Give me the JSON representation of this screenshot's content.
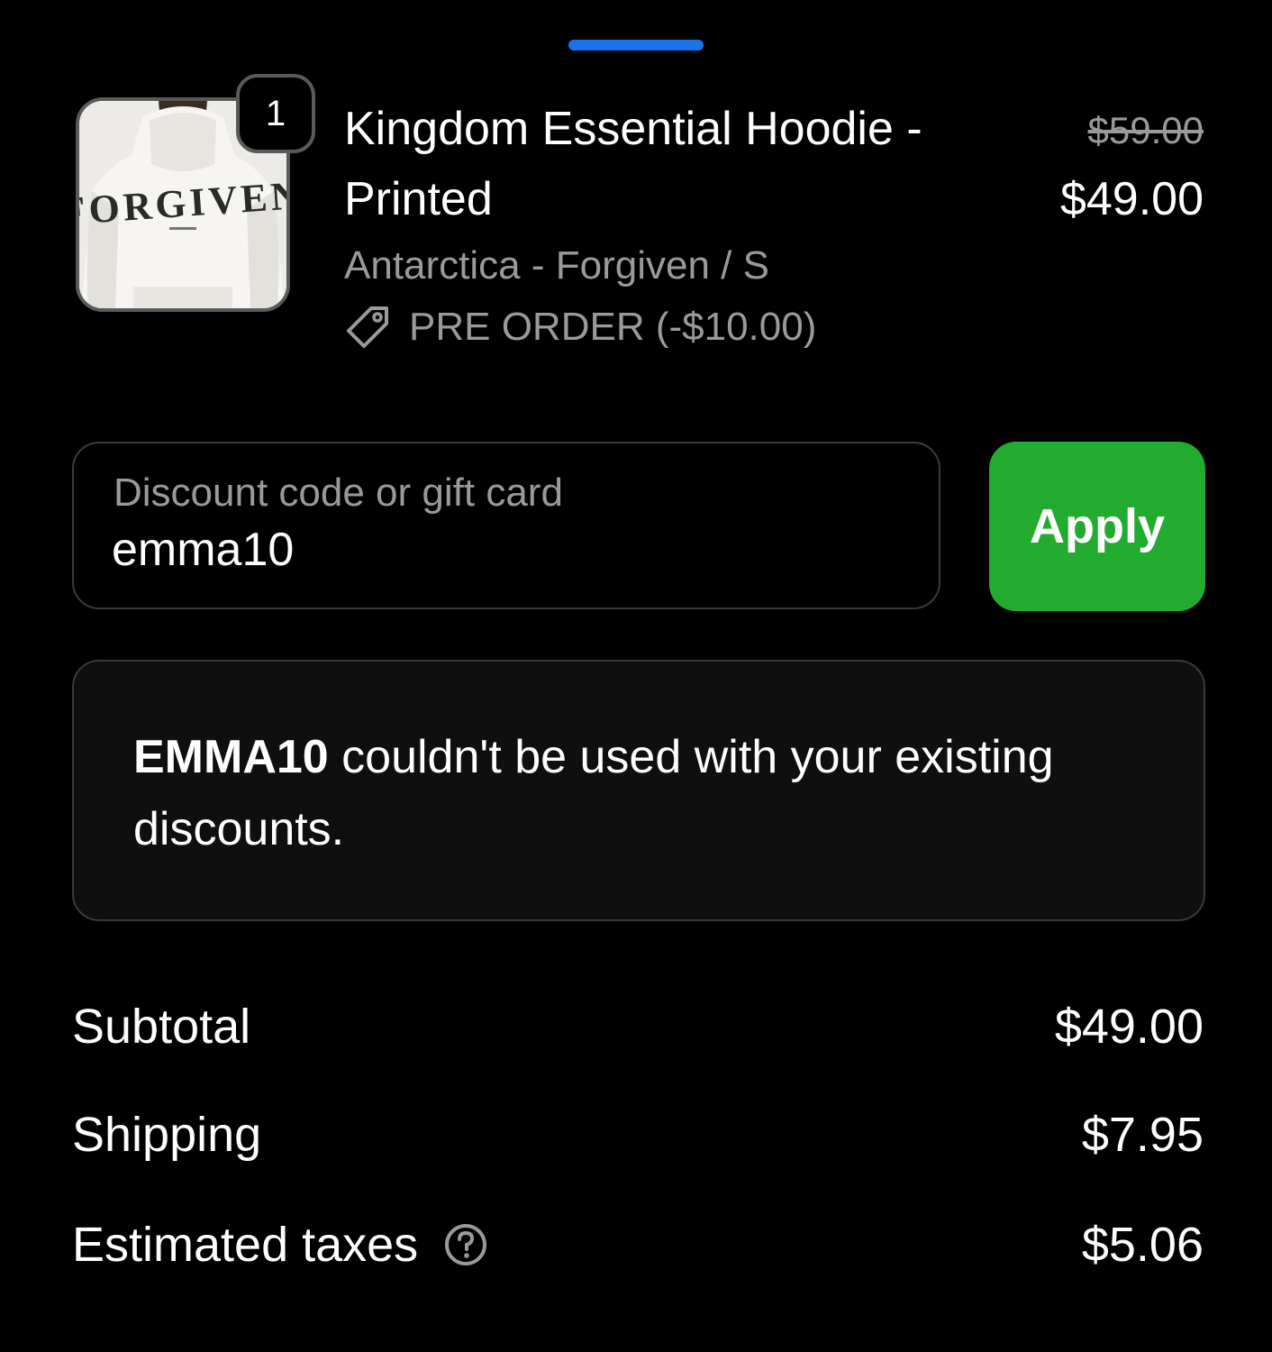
{
  "product": {
    "quantity": "1",
    "title": "Kingdom Essential Hoodie - Printed",
    "variant": "Antarctica - Forgiven / S",
    "discount_label": "PRE ORDER (-$10.00)",
    "price_original": "$59.00",
    "price_current": "$49.00",
    "image_print_text": "FORGIVEN",
    "icons": {
      "discount": "tag-icon"
    }
  },
  "discount_field": {
    "label": "Discount code or gift card",
    "value": "emma10"
  },
  "apply_button": {
    "label": "Apply"
  },
  "error": {
    "code": "EMMA10",
    "message": " couldn't be used with your existing discounts."
  },
  "summary": {
    "subtotal_label": "Subtotal",
    "subtotal_value": "$49.00",
    "shipping_label": "Shipping",
    "shipping_value": "$7.95",
    "taxes_label": "Estimated taxes",
    "taxes_value": "$5.06",
    "icons": {
      "taxes_help": "help-icon"
    }
  },
  "colors": {
    "background": "#000000",
    "accent_handle": "#1a73e8",
    "apply_button": "#22ab2f",
    "muted_text": "#9a9a9a"
  }
}
